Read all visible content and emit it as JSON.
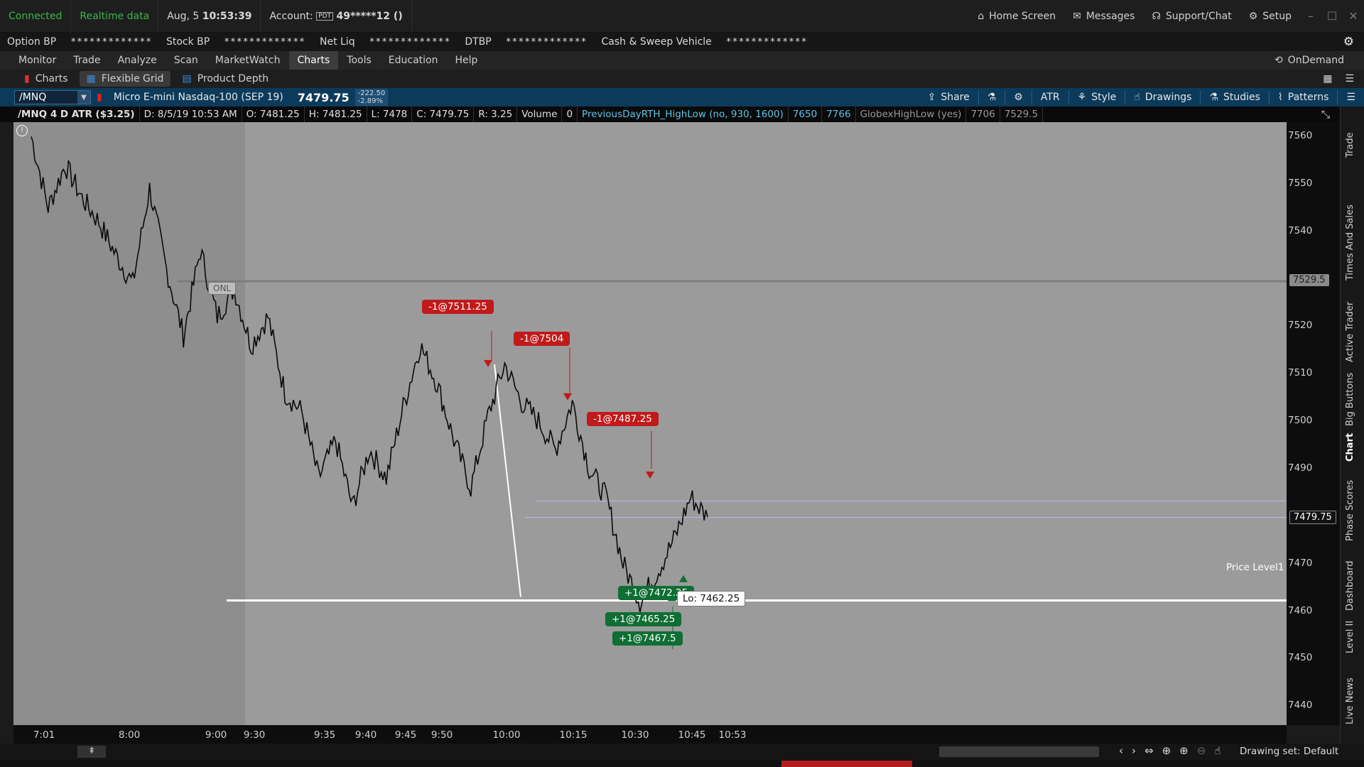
{
  "status": {
    "connection": "Connected",
    "data_feed": "Realtime data",
    "date": "Aug, 5",
    "time": "10:53:39",
    "account_label": "Account:",
    "account_badge": "PDT",
    "account_number": "49*****12 ()",
    "home_screen": "Home Screen",
    "messages": "Messages",
    "support": "Support/Chat",
    "setup": "Setup"
  },
  "balances": {
    "option_bp_label": "Option BP",
    "option_bp_value": "*************",
    "stock_bp_label": "Stock BP",
    "stock_bp_value": "*************",
    "net_liq_label": "Net Liq",
    "net_liq_value": "*************",
    "dtbp_label": "DTBP",
    "dtbp_value": "*************",
    "cash_label": "Cash & Sweep Vehicle",
    "cash_value": "*************"
  },
  "menu": {
    "items": [
      "Monitor",
      "Trade",
      "Analyze",
      "Scan",
      "MarketWatch",
      "Charts",
      "Tools",
      "Education",
      "Help"
    ],
    "active": "Charts",
    "ondemand": "OnDemand"
  },
  "subtabs": [
    "Charts",
    "Flexible Grid",
    "Product Depth"
  ],
  "chart_header": {
    "symbol": "/MNQ",
    "description": "Micro E-mini Nasdaq-100 (SEP 19)",
    "last_price": "7479.75",
    "net_change": "-222.50",
    "pct_change": "-2.89%",
    "buttons": [
      "Share",
      "ATR",
      "Style",
      "Drawings",
      "Studies",
      "Patterns"
    ]
  },
  "info_row": {
    "title": "/MNQ 4 D ATR ($3.25)",
    "datetime": "D: 8/5/19 10:53 AM",
    "open": "O: 7481.25",
    "high": "H: 7481.25",
    "low": "L: 7478",
    "close": "C: 7479.75",
    "range": "R: 3.25",
    "volume_label": "Volume",
    "volume_value": "0",
    "study1": "PreviousDayRTH_HighLow (no, 930, 1600)",
    "study1_v1": "7650",
    "study1_v2": "7766",
    "study2": "GlobexHighLow (yes)",
    "study2_v1": "7706",
    "study2_v2": "7529.5"
  },
  "chart_data": {
    "type": "line",
    "instrument": "/MNQ",
    "y_ticks": [
      7560,
      7550,
      7540,
      7530,
      7520,
      7510,
      7500,
      7490,
      7480,
      7470,
      7460,
      7450,
      7440
    ],
    "y_tick_labels_shown": [
      "7560",
      "7550",
      "7540",
      "7520",
      "7510",
      "7500",
      "7490",
      "7470",
      "7460",
      "7450",
      "7440"
    ],
    "ylim": [
      7436,
      7563
    ],
    "x_tick_labels": [
      "7:01",
      "8:00",
      "9:00",
      "9:30",
      "9:35",
      "9:40",
      "9:45",
      "9:50",
      "10:00",
      "10:15",
      "10:30",
      "10:45",
      "10:53"
    ],
    "price_badges": [
      {
        "label": "7529.5",
        "value": 7529.5
      },
      {
        "label": "7479.75",
        "value": 7479.75
      }
    ],
    "horizontal_lines": [
      {
        "name": "ONL",
        "value": 7529.5
      },
      {
        "name": "Price Level1",
        "value": 7462.25
      }
    ],
    "series": [
      {
        "values": [
          7560,
          7545,
          7554,
          7547,
          7542,
          7535,
          7529,
          7549,
          7532,
          7518,
          7536,
          7522,
          7528,
          7516,
          7522,
          7506,
          7502,
          7488,
          7496,
          7482,
          7494,
          7488,
          7503,
          7516,
          7508,
          7496,
          7486,
          7501,
          7512,
          7504,
          7500,
          7494,
          7504,
          7490,
          7484,
          7470,
          7462,
          7468,
          7475,
          7484,
          7479.75
        ]
      }
    ],
    "orders": [
      {
        "label": "-1@7511.25",
        "side": "sell"
      },
      {
        "label": "-1@7504",
        "side": "sell"
      },
      {
        "label": "-1@7487.25",
        "side": "sell"
      },
      {
        "label": "+1@7472.25",
        "side": "buy"
      },
      {
        "label": "+1@7465.25",
        "side": "buy"
      },
      {
        "label": "+1@7467.5",
        "side": "buy"
      }
    ],
    "low_marker": "Lo: 7462.25",
    "onl_label": "ONL",
    "price_level_label": "Price Level1"
  },
  "side_tabs": [
    "Trade",
    "Times And Sales",
    "Active Trader",
    "Big Buttons",
    "Chart",
    "Phase Scores",
    "Dashboard",
    "Level II",
    "Live News"
  ],
  "bottom": {
    "drawing_set": "Drawing set: Default"
  },
  "colors": {
    "connected": "#3cb54a",
    "sell": "#c01a1a",
    "buy": "#0f6e33",
    "chart_bg": "#9b9b9b",
    "toolbar_bg": "#0c3a5b"
  }
}
